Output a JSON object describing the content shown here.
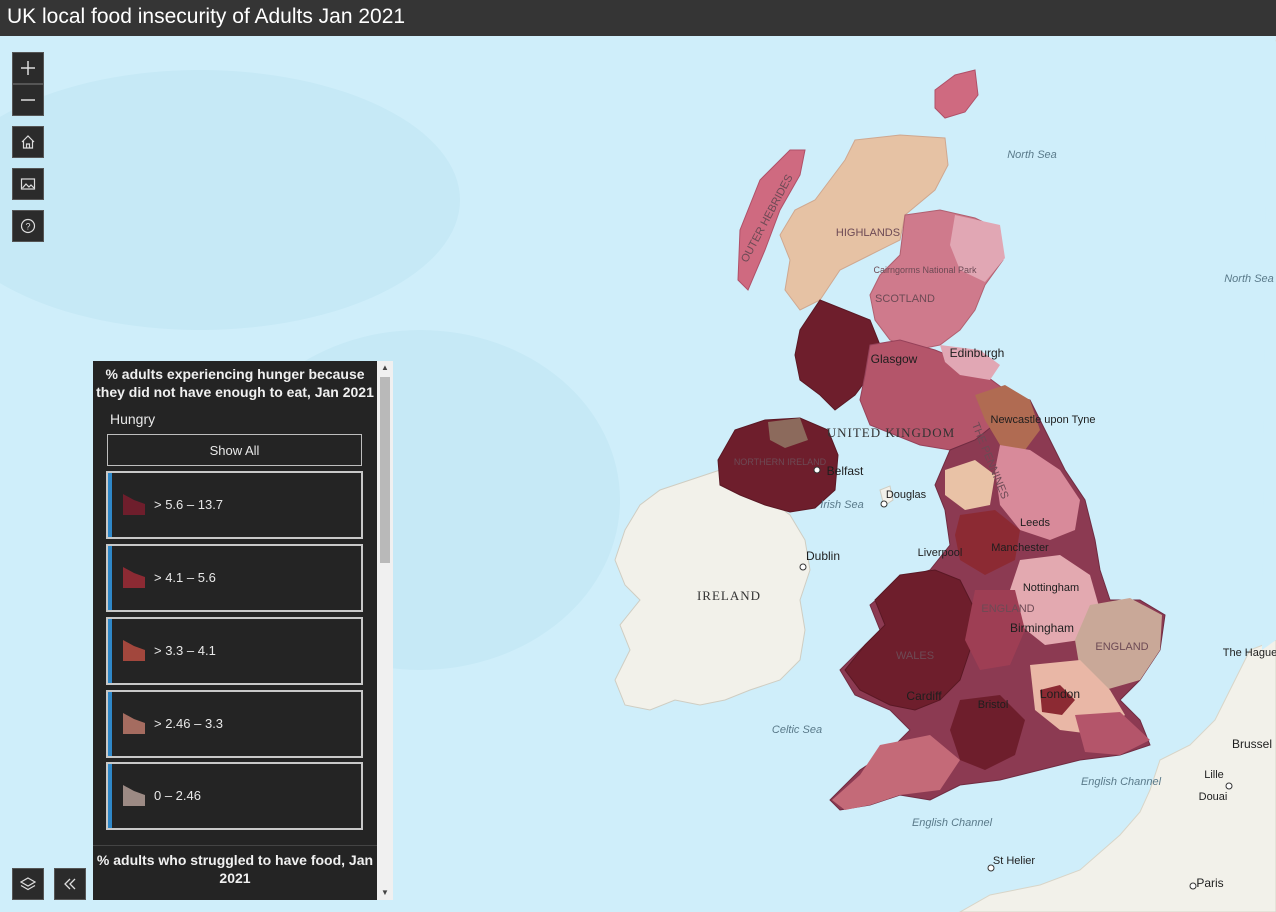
{
  "title": "UK local food insecurity of Adults Jan 2021",
  "controls": {
    "zoom_in_icon": "plus-icon",
    "zoom_out_icon": "minus-icon",
    "home_icon": "home-icon",
    "basemap_icon": "basemap-gallery-icon",
    "help_icon": "question-icon",
    "layers_icon": "layers-icon",
    "collapse_icon": "double-chevron-left-icon"
  },
  "legend": {
    "heading": "% adults experiencing hunger because they did not have enough to eat, Jan 2021",
    "field": "Hungry",
    "show_all": "Show All",
    "items": [
      {
        "label": "> 5.6 – 13.7",
        "color": "#6e1e2c"
      },
      {
        "label": "> 4.1 – 5.6",
        "color": "#8c2a33"
      },
      {
        "label": "> 3.3 – 4.1",
        "color": "#a2473d"
      },
      {
        "label": "> 2.46 – 3.3",
        "color": "#a56c60"
      },
      {
        "label": "0 – 2.46",
        "color": "#9c8a84"
      }
    ],
    "next_heading": "% adults who struggled to have food,  Jan 2021"
  },
  "map_labels": {
    "north_sea_1": "North Sea",
    "north_sea_2": "North Sea",
    "outer_hebrides": "OUTER HEBRIDES",
    "highlands": "HIGHLANDS",
    "cairngorms": "Cairngorms National Park",
    "scotland": "SCOTLAND",
    "glasgow": "Glasgow",
    "edinburgh": "Edinburgh",
    "newcastle": "Newcastle upon Tyne",
    "united_kingdom": "UNITED KINGDOM",
    "the_pennines": "THE PENNINES",
    "northern_ireland": "NORTHERN IRELAND",
    "belfast": "Belfast",
    "douglas": "Douglas",
    "irish_sea": "Irish Sea",
    "leeds": "Leeds",
    "dublin": "Dublin",
    "liverpool": "Liverpool",
    "manchester": "Manchester",
    "ireland": "IRELAND",
    "nottingham": "Nottingham",
    "england_1": "ENGLAND",
    "birmingham": "Birmingham",
    "england_2": "ENGLAND",
    "wales": "WALES",
    "cardiff": "Cardiff",
    "london": "London",
    "bristol": "Bristol",
    "the_hague": "The Hague",
    "brussels": "Brussel",
    "celtic_sea": "Celtic Sea",
    "lille": "Lille",
    "douai": "Douai",
    "english_channel_1": "English Channel",
    "english_channel_2": "English Channel",
    "st_helier": "St Helier",
    "paris": "Paris"
  },
  "colors": {
    "sea": "#cfeefa",
    "land": "#f2f1ea",
    "class_high": "#6e1e2c",
    "class_mid_high": "#8c2a33",
    "class_mid": "#a2473d",
    "class_low_mid": "#c46a78",
    "class_low": "#e3a9b0",
    "class_lowest": "#e9c2a6"
  }
}
